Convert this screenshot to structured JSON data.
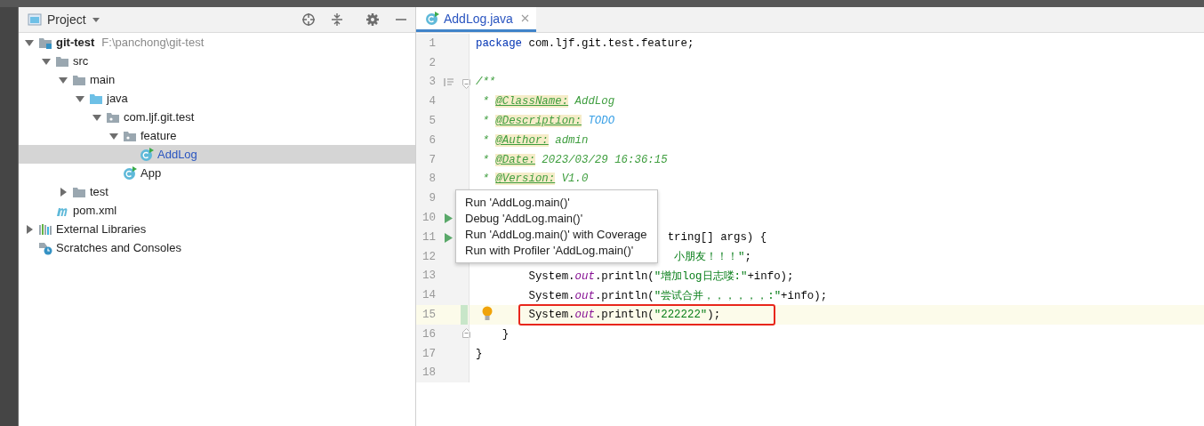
{
  "project_panel": {
    "title": "Project",
    "tree": [
      {
        "label": "git-test",
        "path": "F:\\panchong\\git-test",
        "kind": "module",
        "expanded": true,
        "selected": false,
        "children": [
          {
            "label": "src",
            "kind": "folder",
            "expanded": true,
            "selected": false,
            "children": [
              {
                "label": "main",
                "kind": "folder",
                "expanded": true,
                "selected": false,
                "children": [
                  {
                    "label": "java",
                    "kind": "source_folder",
                    "expanded": true,
                    "selected": false,
                    "children": [
                      {
                        "label": "com.ljf.git.test",
                        "kind": "package",
                        "expanded": true,
                        "selected": false,
                        "children": [
                          {
                            "label": "feature",
                            "kind": "package",
                            "expanded": true,
                            "selected": false,
                            "children": [
                              {
                                "label": "AddLog",
                                "kind": "class",
                                "selected": true
                              }
                            ]
                          },
                          {
                            "label": "App",
                            "kind": "class",
                            "selected": false
                          }
                        ]
                      }
                    ]
                  }
                ]
              },
              {
                "label": "test",
                "kind": "folder",
                "expanded": false,
                "selected": false
              }
            ]
          },
          {
            "label": "pom.xml",
            "kind": "maven",
            "selected": false
          }
        ]
      },
      {
        "label": "External Libraries",
        "kind": "libraries",
        "expanded": false,
        "selected": false
      },
      {
        "label": "Scratches and Consoles",
        "kind": "scratches",
        "selected": false
      }
    ]
  },
  "editor": {
    "tabs": [
      {
        "label": "AddLog.java",
        "selected": true
      }
    ],
    "lines": [
      {
        "number": "1",
        "segments": [
          {
            "kind": "keyword",
            "text": "package"
          },
          {
            "kind": "plain",
            "text": " com.ljf.git.test.feature;"
          }
        ]
      },
      {
        "number": "2"
      },
      {
        "number": "3",
        "doc_toggle": true,
        "fold_start": true,
        "segments": [
          {
            "kind": "comment",
            "text": "/**"
          }
        ]
      },
      {
        "number": "4",
        "segments": [
          {
            "kind": "comment",
            "text": " * "
          },
          {
            "kind": "tag",
            "text": "@ClassName:"
          },
          {
            "kind": "comment",
            "text": " AddLog"
          }
        ]
      },
      {
        "number": "5",
        "segments": [
          {
            "kind": "comment",
            "text": " * "
          },
          {
            "kind": "tag",
            "text": "@Description:"
          },
          {
            "kind": "todo",
            "text": " TODO"
          }
        ]
      },
      {
        "number": "6",
        "segments": [
          {
            "kind": "comment",
            "text": " * "
          },
          {
            "kind": "tag",
            "text": "@Author:"
          },
          {
            "kind": "comment",
            "text": " admin"
          }
        ]
      },
      {
        "number": "7",
        "segments": [
          {
            "kind": "comment",
            "text": " * "
          },
          {
            "kind": "tag",
            "text": "@Date:"
          },
          {
            "kind": "comment",
            "text": " 2023/03/29 16:36:15"
          }
        ]
      },
      {
        "number": "8",
        "segments": [
          {
            "kind": "comment",
            "text": " * "
          },
          {
            "kind": "tag",
            "text": "@Version:"
          },
          {
            "kind": "comment",
            "text": " V1.0"
          }
        ]
      },
      {
        "number": "9"
      },
      {
        "number": "10",
        "run_marker": true
      },
      {
        "number": "11",
        "run_marker": true,
        "segments": [
          {
            "kind": "plain",
            "text": "                             tring[] args) {"
          }
        ]
      },
      {
        "number": "12",
        "segments": [
          {
            "kind": "string",
            "text": "                              小朋友！！！\""
          },
          {
            "kind": "plain",
            "text": ";"
          }
        ]
      },
      {
        "number": "13",
        "segments": [
          {
            "kind": "plain",
            "text": "        System."
          },
          {
            "kind": "field",
            "text": "out"
          },
          {
            "kind": "plain",
            "text": ".println("
          },
          {
            "kind": "string",
            "text": "\"增加log日志喽:\""
          },
          {
            "kind": "plain",
            "text": "+info);"
          }
        ]
      },
      {
        "number": "14",
        "segments": [
          {
            "kind": "plain",
            "text": "        System."
          },
          {
            "kind": "field",
            "text": "out"
          },
          {
            "kind": "plain",
            "text": ".println("
          },
          {
            "kind": "string",
            "text": "\"尝试合并，，，，，，:\""
          },
          {
            "kind": "plain",
            "text": "+info);"
          }
        ]
      },
      {
        "number": "15",
        "current": true,
        "changed": true,
        "bulb": true,
        "outlined": true,
        "segments": [
          {
            "kind": "plain",
            "text": "        System."
          },
          {
            "kind": "field",
            "text": "out"
          },
          {
            "kind": "plain",
            "text": ".println("
          },
          {
            "kind": "string",
            "text": "\"222222\""
          },
          {
            "kind": "plain",
            "text": ");"
          }
        ]
      },
      {
        "number": "16",
        "fold_end": true,
        "segments": [
          {
            "kind": "plain",
            "text": "    }"
          }
        ]
      },
      {
        "number": "17",
        "segments": [
          {
            "kind": "plain",
            "text": "}"
          }
        ]
      },
      {
        "number": "18"
      }
    ],
    "context_menu": {
      "items": [
        "Run 'AddLog.main()'",
        "Debug 'AddLog.main()'",
        "Run 'AddLog.main()' with Coverage",
        "Run with Profiler 'AddLog.main()'"
      ]
    }
  }
}
